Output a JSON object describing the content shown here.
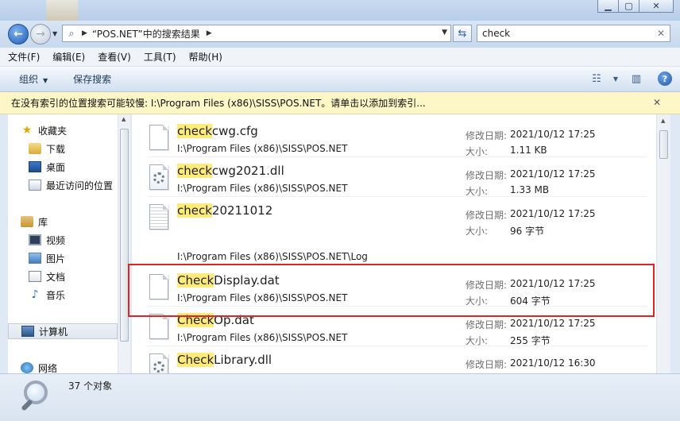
{
  "window": {
    "min_label": "▁",
    "max_label": "▢",
    "close_label": "✕"
  },
  "address": {
    "path": "“POS.NET”中的搜索结果"
  },
  "search": {
    "query": "check"
  },
  "menu": [
    "文件(F)",
    "编辑(E)",
    "查看(V)",
    "工具(T)",
    "帮助(H)"
  ],
  "toolbar": {
    "organize": "组织",
    "save_search": "保存搜索"
  },
  "infobar": {
    "text": "在没有索引的位置搜索可能较慢: I:\\Program Files (x86)\\SISS\\POS.NET。请单击以添加到索引..."
  },
  "nav": {
    "favorites": "收藏夹",
    "downloads": "下载",
    "desktop": "桌面",
    "recent": "最近访问的位置",
    "libraries": "库",
    "videos": "视频",
    "pictures": "图片",
    "documents": "文档",
    "music": "音乐",
    "computer": "计算机",
    "network": "网络"
  },
  "labels": {
    "modified": "修改日期:",
    "size": "大小:"
  },
  "files": [
    {
      "match": "check",
      "rest": "cwg.cfg",
      "path": "I:\\Program Files (x86)\\SISS\\POS.NET",
      "date": "2021/10/12 17:25",
      "size": "1.11 KB",
      "icon": "file-icon"
    },
    {
      "match": "check",
      "rest": "cwg2021.dll",
      "path": "I:\\Program Files (x86)\\SISS\\POS.NET",
      "date": "2021/10/12 17:25",
      "size": "1.33 MB",
      "icon": "dll-file-icon"
    },
    {
      "match": "check",
      "rest": "20211012",
      "path": "I:\\Program Files (x86)\\SISS\\POS.NET\\Log",
      "date": "2021/10/12 17:25",
      "size": "96 字节",
      "icon": "log-file-icon"
    },
    {
      "match": "Check",
      "rest": "Display.dat",
      "path": "I:\\Program Files (x86)\\SISS\\POS.NET",
      "date": "2021/10/12 17:25",
      "size": "604 字节",
      "icon": "file-icon"
    },
    {
      "match": "Check",
      "rest": "Op.dat",
      "path": "I:\\Program Files (x86)\\SISS\\POS.NET",
      "date": "2021/10/12 17:25",
      "size": "255 字节",
      "icon": "file-icon"
    },
    {
      "match": "Check",
      "rest": "Library.dll",
      "path": "",
      "date": "2021/10/12 16:30",
      "size": "",
      "icon": "dll-file-icon"
    }
  ],
  "status": {
    "count": "37 个对象"
  },
  "colors": {
    "highlight": "#ffeb7a",
    "annotation_box": "#e02424",
    "infobar": "#fdf6c7"
  }
}
